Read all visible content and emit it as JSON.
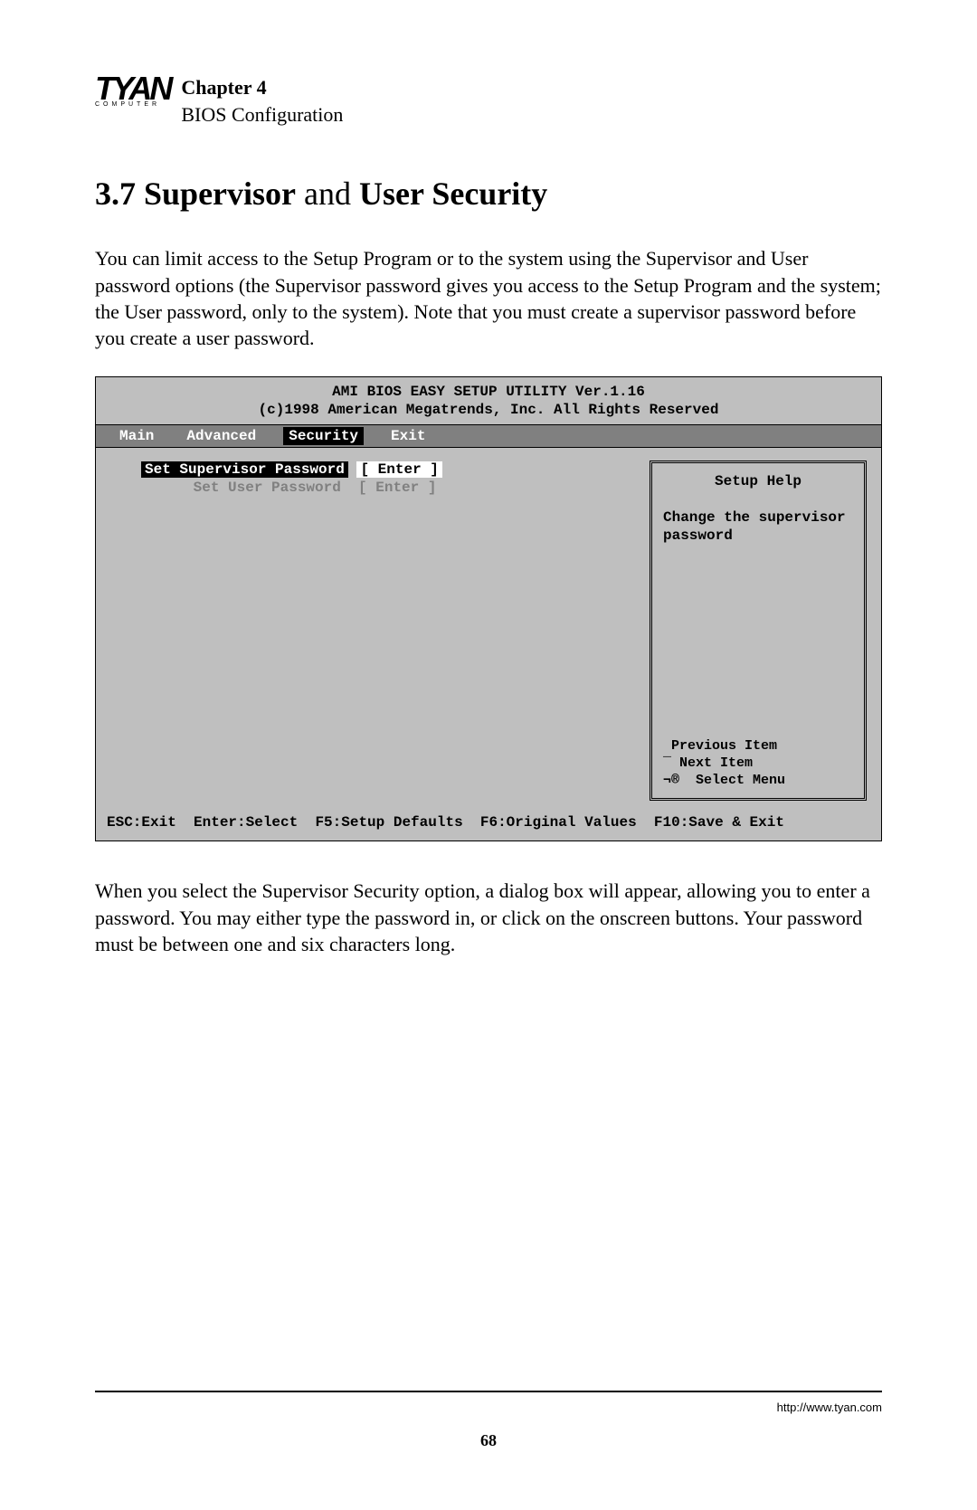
{
  "logo": {
    "main": "TYAN",
    "sub": "COMPUTER"
  },
  "chapter": {
    "label": "Chapter 4",
    "subtitle": "BIOS Configuration"
  },
  "section": {
    "number": "3.7",
    "title_bold1": "Supervisor",
    "title_mid": " and ",
    "title_bold2": "User Security"
  },
  "intro_paragraph": "You can limit access to the Setup Program or to the system using the Supervisor and User password options (the Supervisor password gives you access to the Setup Program and the system; the User password, only to the system). Note that you must create a supervisor password before you create a user password.",
  "bios": {
    "title": "AMI BIOS EASY SETUP UTILITY Ver.1.16",
    "copyright": "(c)1998 American Megatrends, Inc.  All Rights Reserved",
    "tabs": {
      "main": "Main",
      "advanced": "Advanced",
      "security": "Security",
      "exit": "Exit"
    },
    "items": {
      "supervisor_label": "Set Supervisor Password",
      "supervisor_value": "[ Enter ]",
      "user_label": "Set User Password",
      "user_value": "[ Enter ]"
    },
    "help": {
      "title": "Setup Help",
      "text": "Change the supervisor password",
      "nav_prev": "­ Previous Item",
      "nav_next": "¯ Next Item",
      "nav_select": "¬®  Select Menu"
    },
    "footer": "ESC:Exit  Enter:Select  F5:Setup Defaults  F6:Original Values  F10:Save & Exit"
  },
  "after_paragraph": "When you select the Supervisor Security option, a dialog box will appear, allowing you to enter a password. You may either type the password in, or click on the onscreen buttons. Your password must be between one and six characters long.",
  "footer": {
    "url": "http://www.tyan.com",
    "page": "68"
  }
}
